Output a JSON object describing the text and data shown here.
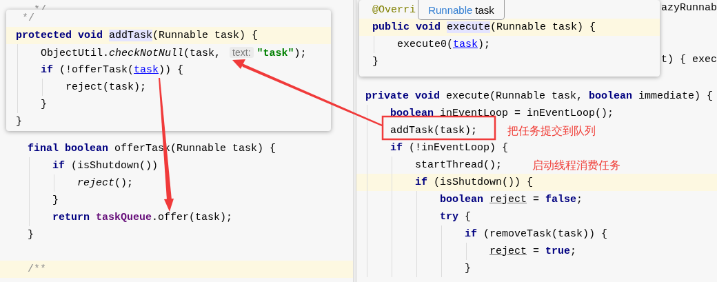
{
  "left_editor": {
    "top_lines": [
      {
        "kind": "code",
        "current": false,
        "tokens": [
          {
            "text": "*/",
            "kind": "doc"
          }
        ]
      }
    ],
    "lines": [
      {
        "kind": "code",
        "current": false,
        "tokens": [
          {
            "text": "final boolean ",
            "kind": "keyword"
          },
          {
            "text": "offerTask(Runnable task) {",
            "kind": "plain"
          }
        ],
        "children": [
          {
            "kind": "code",
            "current": false,
            "tokens": [
              {
                "text": "if ",
                "kind": "keyword"
              },
              {
                "text": "(isShutdown())",
                "kind": "plain"
              }
            ],
            "children": [
              {
                "kind": "code",
                "current": false,
                "tokens": [
                  {
                    "text": "reject",
                    "kind": "italic"
                  },
                  {
                    "text": "();",
                    "kind": "plain"
                  }
                ]
              }
            ]
          },
          {
            "kind": "code",
            "current": false,
            "tokens": [
              {
                "text": "}",
                "kind": "plain"
              }
            ]
          },
          {
            "kind": "code",
            "current": false,
            "tokens": [
              {
                "text": "return ",
                "kind": "keyword"
              },
              {
                "text": "taskQueue",
                "kind": "field"
              },
              {
                "text": ".offer(task);",
                "kind": "plain"
              }
            ]
          }
        ]
      },
      {
        "kind": "code",
        "current": false,
        "tokens": [
          {
            "text": "}",
            "kind": "plain"
          }
        ]
      },
      {
        "kind": "code",
        "current": true,
        "tokens": [
          {
            "text": "/**",
            "kind": "comment"
          }
        ]
      }
    ]
  },
  "left_popup": {
    "lines": [
      {
        "kind": "code",
        "current": false,
        "tokens": [
          {
            "text": "*/",
            "kind": "doc"
          }
        ]
      },
      {
        "kind": "code",
        "current": true,
        "tokens": [
          {
            "text": "protected void ",
            "kind": "keyword"
          },
          {
            "text": "addTask",
            "kind": "usage"
          },
          {
            "text": "(Runnable task) {",
            "kind": "plain"
          }
        ],
        "children": [
          {
            "kind": "code",
            "current": false,
            "tokens": [
              {
                "text": "ObjectUtil.",
                "kind": "plain"
              },
              {
                "text": "checkNotNull",
                "kind": "italic"
              },
              {
                "text": "(task, ",
                "kind": "plain"
              },
              {
                "text": "text:",
                "kind": "hint"
              },
              {
                "text": "\"task\"",
                "kind": "string"
              },
              {
                "text": ");",
                "kind": "plain"
              }
            ]
          },
          {
            "kind": "code",
            "current": false,
            "tokens": [
              {
                "text": "if ",
                "kind": "keyword"
              },
              {
                "text": "(!offerTask(",
                "kind": "plain"
              },
              {
                "text": "task",
                "kind": "link"
              },
              {
                "text": ")) {",
                "kind": "plain"
              }
            ],
            "children": [
              {
                "kind": "code",
                "current": false,
                "tokens": [
                  {
                    "text": "reject(task);",
                    "kind": "plain"
                  }
                ]
              }
            ]
          },
          {
            "kind": "code",
            "current": false,
            "tokens": [
              {
                "text": "}",
                "kind": "plain"
              }
            ]
          }
        ]
      },
      {
        "kind": "code",
        "current": false,
        "tokens": [
          {
            "text": "}",
            "kind": "plain"
          }
        ]
      }
    ]
  },
  "right_editor": {
    "partial_lines": [
      "azyRunnab",
      "t) { exec"
    ],
    "lines": [
      {
        "kind": "code",
        "current": false,
        "tokens": [
          {
            "text": "private void ",
            "kind": "keyword"
          },
          {
            "text": "execute(Runnable task, ",
            "kind": "plain"
          },
          {
            "text": "boolean ",
            "kind": "keyword"
          },
          {
            "text": "immediate) {",
            "kind": "plain"
          }
        ],
        "children": [
          {
            "kind": "code",
            "current": false,
            "tokens": [
              {
                "text": "boolean ",
                "kind": "keyword"
              },
              {
                "text": "inEventLoop = inEventLoop();",
                "kind": "plain"
              }
            ]
          },
          {
            "kind": "code",
            "current": false,
            "tokens": [
              {
                "text": "addTask(task);",
                "kind": "plain"
              }
            ],
            "note": "把任务提交到队列"
          },
          {
            "kind": "code",
            "current": false,
            "tokens": [
              {
                "text": "if ",
                "kind": "keyword"
              },
              {
                "text": "(!inEventLoop) {",
                "kind": "plain"
              }
            ],
            "children": [
              {
                "kind": "code",
                "current": false,
                "tokens": [
                  {
                    "text": "startThread();",
                    "kind": "plain"
                  }
                ],
                "note": "启动线程消费任务"
              },
              {
                "kind": "code",
                "current": true,
                "tokens": [
                  {
                    "text": "if ",
                    "kind": "keyword"
                  },
                  {
                    "text": "(isShutdown()) {",
                    "kind": "plain"
                  }
                ],
                "children": [
                  {
                    "kind": "code",
                    "current": false,
                    "tokens": [
                      {
                        "text": "boolean ",
                        "kind": "keyword"
                      },
                      {
                        "text": "reject",
                        "kind": "variable"
                      },
                      {
                        "text": " = ",
                        "kind": "plain"
                      },
                      {
                        "text": "false",
                        "kind": "keyword"
                      },
                      {
                        "text": ";",
                        "kind": "plain"
                      }
                    ]
                  },
                  {
                    "kind": "code",
                    "current": false,
                    "tokens": [
                      {
                        "text": "try ",
                        "kind": "keyword"
                      },
                      {
                        "text": "{",
                        "kind": "plain"
                      }
                    ],
                    "children": [
                      {
                        "kind": "code",
                        "current": false,
                        "tokens": [
                          {
                            "text": "if ",
                            "kind": "keyword"
                          },
                          {
                            "text": "(removeTask(task)) {",
                            "kind": "plain"
                          }
                        ],
                        "children": [
                          {
                            "kind": "code",
                            "current": false,
                            "tokens": [
                              {
                                "text": "reject",
                                "kind": "variable"
                              },
                              {
                                "text": " = ",
                                "kind": "plain"
                              },
                              {
                                "text": "true",
                                "kind": "keyword"
                              },
                              {
                                "text": ";",
                                "kind": "plain"
                              }
                            ]
                          }
                        ]
                      },
                      {
                        "kind": "code",
                        "current": false,
                        "tokens": [
                          {
                            "text": "}",
                            "kind": "plain"
                          }
                        ]
                      }
                    ]
                  }
                ]
              }
            ]
          }
        ]
      }
    ]
  },
  "right_popup": {
    "lines": [
      {
        "kind": "code",
        "current": false,
        "tokens": [
          {
            "text": "@Overri",
            "kind": "annotation"
          }
        ]
      },
      {
        "kind": "code",
        "current": true,
        "tokens": [
          {
            "text": "public void ",
            "kind": "keyword"
          },
          {
            "text": "execute",
            "kind": "usage"
          },
          {
            "text": "(Runnable task) {",
            "kind": "plain"
          }
        ],
        "children": [
          {
            "kind": "code",
            "current": false,
            "tokens": [
              {
                "text": "execute0(",
                "kind": "plain"
              },
              {
                "text": "task",
                "kind": "link"
              },
              {
                "text": ");",
                "kind": "plain"
              }
            ]
          }
        ]
      },
      {
        "kind": "code",
        "current": false,
        "tokens": [
          {
            "text": "}",
            "kind": "plain"
          }
        ]
      }
    ]
  },
  "tooltip": {
    "type_name": "Runnable",
    "parameter": "task"
  }
}
